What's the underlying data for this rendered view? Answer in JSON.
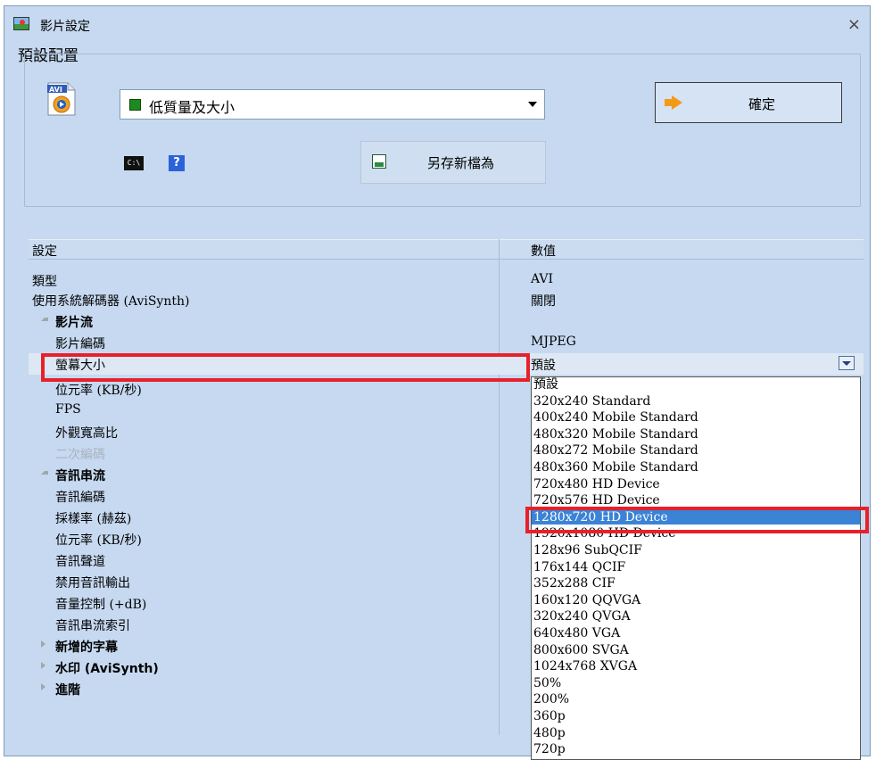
{
  "window": {
    "title": "影片設定",
    "close_label": "×"
  },
  "preset": {
    "group_label": "預設配置",
    "selected": "低質量及大小",
    "ok_label": "確定",
    "saveas_label": "另存新檔為",
    "cmd_icon_text": "C:\\"
  },
  "grid": {
    "header": {
      "setting": "設定",
      "value": "數值"
    },
    "rows": [
      {
        "label": "類型",
        "value": "AVI"
      },
      {
        "label": "使用系統解碼器 (AviSynth)",
        "value": "關閉"
      },
      {
        "label": "影片流",
        "value": ""
      },
      {
        "label": "影片編碼",
        "value": "MJPEG"
      },
      {
        "label": "螢幕大小",
        "value": "預設"
      },
      {
        "label": "位元率 (KB/秒)",
        "value": ""
      },
      {
        "label": "FPS",
        "value": ""
      },
      {
        "label": "外觀寬高比",
        "value": ""
      },
      {
        "label": "二次編碼",
        "value": ""
      },
      {
        "label": "音訊串流",
        "value": ""
      },
      {
        "label": "音訊編碼",
        "value": ""
      },
      {
        "label": "採樣率 (赫茲)",
        "value": ""
      },
      {
        "label": "位元率 (KB/秒)",
        "value": ""
      },
      {
        "label": "音訊聲道",
        "value": ""
      },
      {
        "label": "禁用音訊輸出",
        "value": ""
      },
      {
        "label": "音量控制 (+dB)",
        "value": ""
      },
      {
        "label": "音訊串流索引",
        "value": ""
      },
      {
        "label": "新增的字幕",
        "value": ""
      },
      {
        "label": "水印 (AviSynth)",
        "value": ""
      },
      {
        "label": "進階",
        "value": ""
      }
    ]
  },
  "dropdown": {
    "options": [
      "預設",
      "320x240  Standard",
      "400x240  Mobile Standard",
      "480x320  Mobile Standard",
      "480x272  Mobile Standard",
      "480x360  Mobile Standard",
      "720x480  HD Device",
      "720x576  HD Device",
      "1280x720 HD Device",
      "1920x1080 HD Device",
      "128x96  SubQCIF",
      "176x144  QCIF",
      "352x288  CIF",
      "160x120  QQVGA",
      "320x240  QVGA",
      "640x480  VGA",
      "800x600  SVGA",
      "1024x768 XVGA",
      "50%",
      "200%",
      "360p",
      "480p",
      "720p"
    ],
    "selected": "1280x720 HD Device"
  },
  "colors": {
    "window_bg": "#c6d9f0",
    "selection": "#3a83d6",
    "highlight_box": "#e8202a"
  }
}
